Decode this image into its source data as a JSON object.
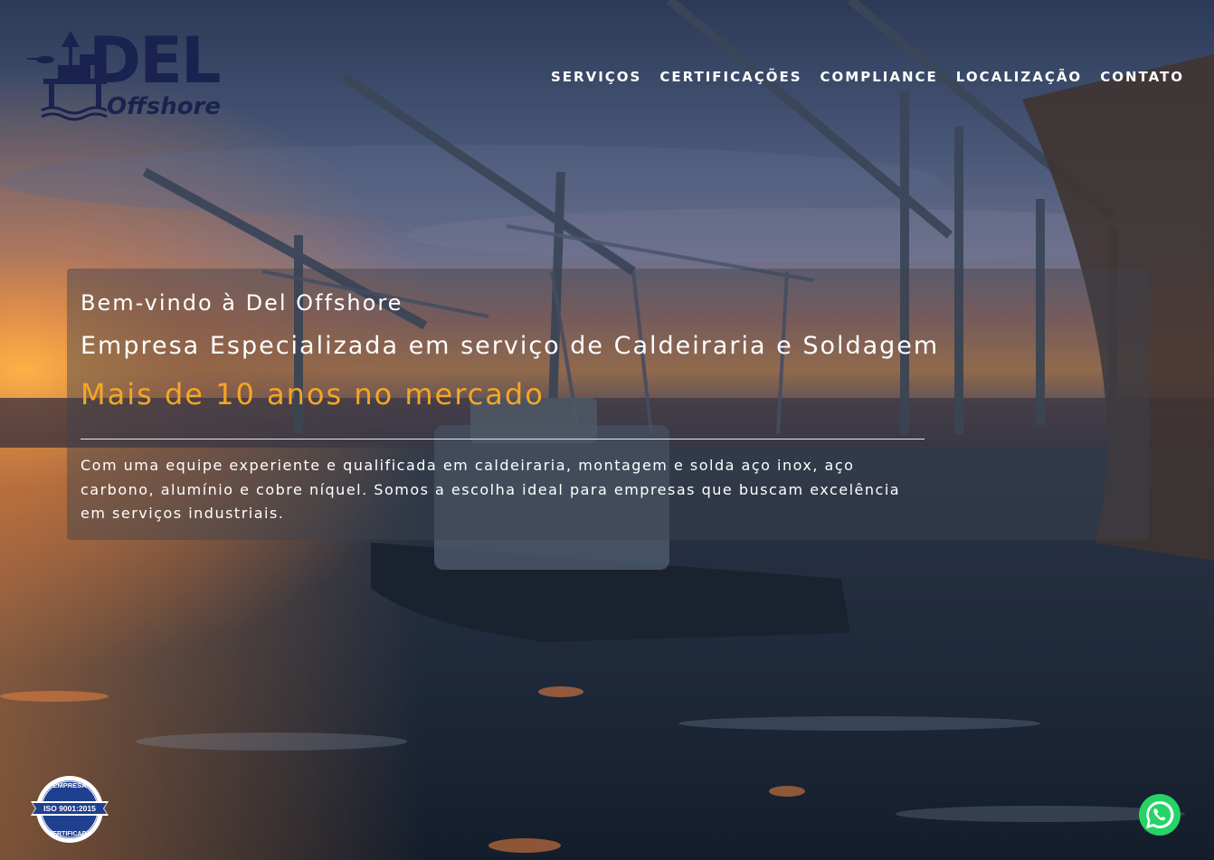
{
  "logo": {
    "brand": "DEL",
    "sub": "Offshore"
  },
  "nav": {
    "items": [
      {
        "label": "SERVIÇOS"
      },
      {
        "label": "CERTIFICAÇÕES"
      },
      {
        "label": "COMPLIANCE"
      },
      {
        "label": "LOCALIZAÇÃO"
      },
      {
        "label": "CONTATO"
      }
    ]
  },
  "hero": {
    "welcome": "Bem-vindo à Del Offshore",
    "specialty": "Empresa Especializada em serviço de Caldeiraria e Soldagem",
    "years": "Mais de 10 anos no mercado",
    "description": "Com uma equipe experiente e qualificada em caldeiraria, montagem e solda aço inox, aço carbono, alumínio e cobre níquel. Somos a escolha ideal para empresas que buscam excelência em serviços industriais."
  },
  "badge": {
    "top": "EMPRESA",
    "middle": "ISO 9001:2015",
    "bottom": "CERTIFICADA"
  },
  "whatsapp": {
    "icon": "whatsapp-icon"
  },
  "colors": {
    "accent": "#f5a623",
    "brand": "#1a2350",
    "whatsapp": "#25d366"
  }
}
